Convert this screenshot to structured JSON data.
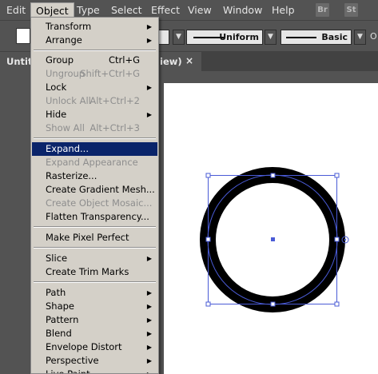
{
  "menubar": {
    "items": [
      "Edit",
      "Object",
      "Type",
      "Select",
      "Effect",
      "View",
      "Window",
      "Help"
    ],
    "active": "Object",
    "badges": [
      "Br",
      "St"
    ]
  },
  "controlbar": {
    "profile_label": "Uniform",
    "brush_label": "Basic",
    "opacity_label": "O"
  },
  "tab": {
    "title_left": "Untitl",
    "title_right": "iew)",
    "close_glyph": "×"
  },
  "object_menu": {
    "transform": "Transform",
    "arrange": "Arrange",
    "group": "Group",
    "group_sc": "Ctrl+G",
    "ungroup": "Ungroup",
    "ungroup_sc": "Shift+Ctrl+G",
    "lock": "Lock",
    "unlock_all": "Unlock All",
    "unlock_all_sc": "Alt+Ctrl+2",
    "hide": "Hide",
    "show_all": "Show All",
    "show_all_sc": "Alt+Ctrl+3",
    "expand": "Expand...",
    "expand_appearance": "Expand Appearance",
    "rasterize": "Rasterize...",
    "create_gradient_mesh": "Create Gradient Mesh...",
    "create_object_mosaic": "Create Object Mosaic...",
    "flatten_transparency": "Flatten Transparency...",
    "make_pixel_perfect": "Make Pixel Perfect",
    "slice": "Slice",
    "create_trim_marks": "Create Trim Marks",
    "path": "Path",
    "shape": "Shape",
    "pattern": "Pattern",
    "blend": "Blend",
    "envelope_distort": "Envelope Distort",
    "perspective": "Perspective",
    "live_paint": "Live Paint"
  },
  "colors": {
    "menu_bg": "#d4d0c8",
    "highlight": "#0a246a",
    "selection_blue": "#4a5bd6",
    "ui_gray": "#535353"
  },
  "icons": [
    "submenu-arrow-icon",
    "close-icon",
    "dropdown-chevron-icon",
    "anchor-point-icon",
    "center-point-icon"
  ]
}
